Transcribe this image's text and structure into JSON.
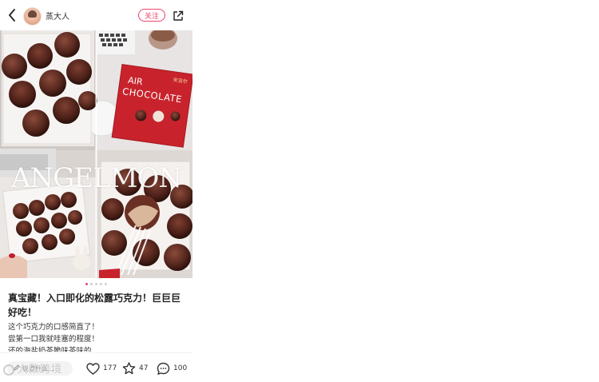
{
  "header": {
    "username": "蒸大人",
    "follow_label": "关注"
  },
  "photo": {
    "brand_text": "ANGELMON",
    "box_line1": "AIR",
    "box_line2": "CHOCOLATE",
    "box_badge": "安吉尔"
  },
  "carousel": {
    "total": 5,
    "active": 1
  },
  "post": {
    "title": "真宝藏！入口即化的松露巧克力！巨巨巨好吃！",
    "body": [
      "这个巧克力的口感简直了！",
      "尝第一口我就哇塞的程度！",
      "还的海盐奶茶脆味茶味的"
    ]
  },
  "bottom_bar": {
    "comment_placeholder": "说点什么...",
    "likes": "177",
    "favorites": "47",
    "comments": "100"
  },
  "watermark": "大数跨境",
  "colors": {
    "accent": "#e8456a",
    "box_red": "#c8232c"
  }
}
